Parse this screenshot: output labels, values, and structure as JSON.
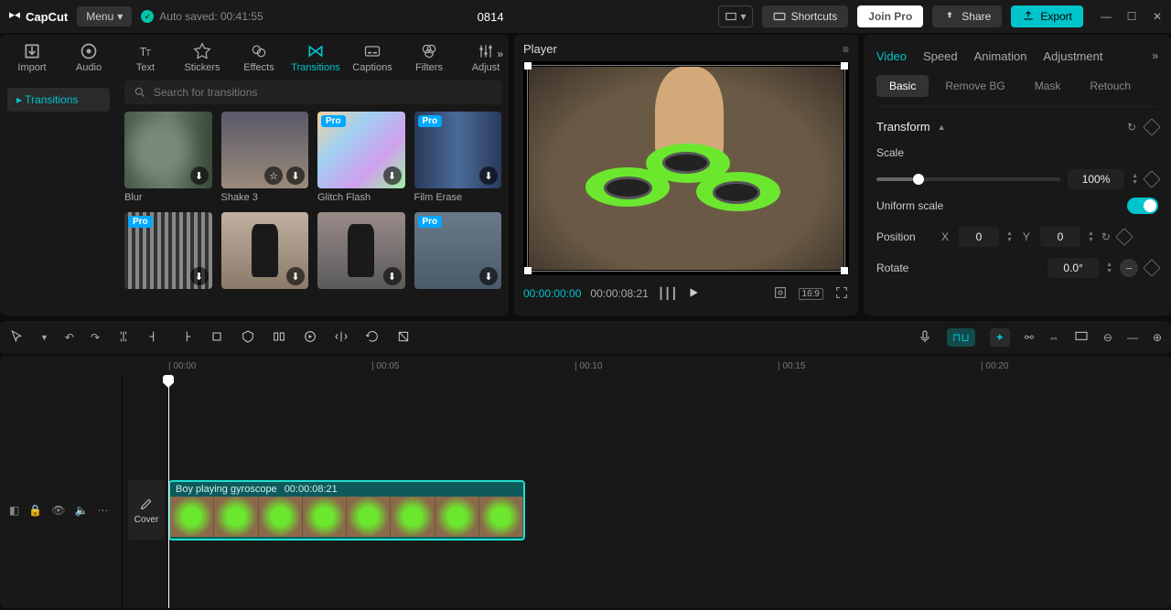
{
  "app": {
    "name": "CapCut"
  },
  "titlebar": {
    "menu": "Menu",
    "autosave": "Auto saved: 00:41:55",
    "project": "0814",
    "shortcuts": "Shortcuts",
    "joinpro": "Join Pro",
    "share": "Share",
    "export": "Export"
  },
  "mediaTabs": {
    "import": "Import",
    "audio": "Audio",
    "text": "Text",
    "stickers": "Stickers",
    "effects": "Effects",
    "transitions": "Transitions",
    "captions": "Captions",
    "filters": "Filters",
    "adjust": "Adjust"
  },
  "sideNav": {
    "item1": "Transitions"
  },
  "search": {
    "placeholder": "Search for transitions"
  },
  "cards": {
    "c1": "Blur",
    "c2": "Shake 3",
    "c3": "Glitch Flash",
    "c4": "Film Erase",
    "pro": "Pro"
  },
  "player": {
    "title": "Player",
    "cur": "00:00:00:00",
    "dur": "00:00:08:21",
    "ratio": "16:9"
  },
  "inspector": {
    "tabs": {
      "video": "Video",
      "speed": "Speed",
      "animation": "Animation",
      "adjustment": "Adjustment"
    },
    "sub": {
      "basic": "Basic",
      "removebg": "Remove BG",
      "mask": "Mask",
      "retouch": "Retouch"
    },
    "section": "Transform",
    "scale": {
      "label": "Scale",
      "value": "100%"
    },
    "uniform": "Uniform scale",
    "position": {
      "label": "Position",
      "x": "X",
      "xv": "0",
      "y": "Y",
      "yv": "0"
    },
    "rotate": {
      "label": "Rotate",
      "value": "0.0°"
    }
  },
  "ruler": {
    "t0": "00:00",
    "t1": "00:05",
    "t2": "00:10",
    "t3": "00:15",
    "t4": "00:20"
  },
  "clip": {
    "name": "Boy playing gyroscope",
    "dur": "00:00:08:21"
  },
  "cover": "Cover"
}
